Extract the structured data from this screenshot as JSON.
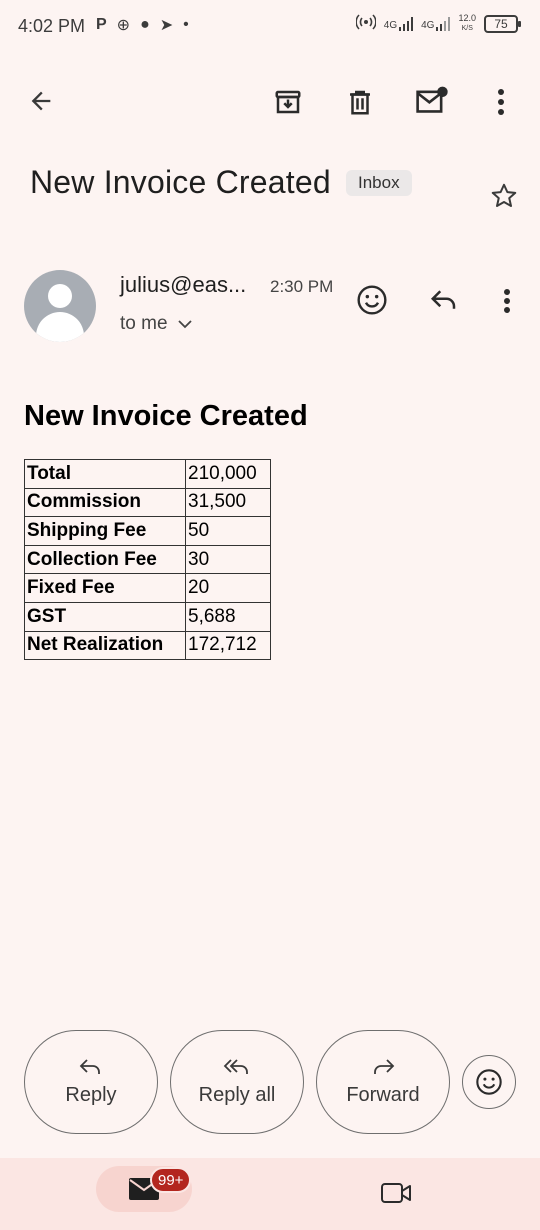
{
  "status_bar": {
    "time": "4:02 PM",
    "left_icons": [
      "P",
      "⊕",
      "●",
      "➤",
      "•"
    ],
    "net_type_1": "4G",
    "net_type_2": "4G",
    "net_speed_value": "12.0",
    "net_speed_unit": "K/S",
    "battery": "75"
  },
  "toolbar": {
    "back_icon": "arrow-back-icon",
    "archive_icon": "archive-icon",
    "delete_icon": "delete-icon",
    "mark_unread_icon": "mark-unread-icon",
    "more_icon": "more-vert-icon"
  },
  "email": {
    "subject": "New Invoice Created",
    "label": "Inbox",
    "sender": "julius@eas...",
    "time": "2:30 PM",
    "recipient": "to me",
    "body_title": "New Invoice Created",
    "invoice_rows": [
      {
        "key": "Total",
        "value": "210,000"
      },
      {
        "key": "Commission",
        "value": "31,500"
      },
      {
        "key": "Shipping Fee",
        "value": "50"
      },
      {
        "key": "Collection Fee",
        "value": "30"
      },
      {
        "key": "Fixed Fee",
        "value": "20"
      },
      {
        "key": "GST",
        "value": "5,688"
      },
      {
        "key": "Net Realization",
        "value": "172,712"
      }
    ]
  },
  "actions": {
    "reply": "Reply",
    "reply_all": "Reply all",
    "forward": "Forward"
  },
  "bottom_nav": {
    "mail_badge": "99+"
  },
  "colors": {
    "background": "#fdf4f2",
    "bottom_nav": "#fbe6e3",
    "badge": "#b3261e"
  }
}
